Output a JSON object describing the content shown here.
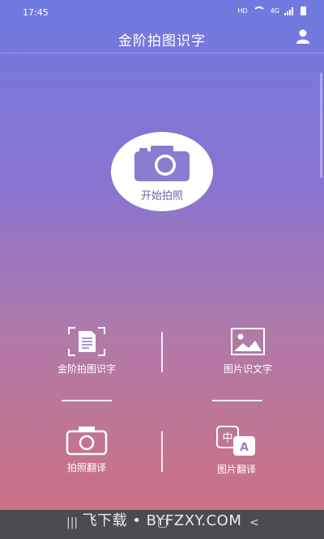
{
  "status": {
    "time": "17:45",
    "network": "HD",
    "signal": "4G"
  },
  "header": {
    "title": "金阶拍图识字",
    "user_icon": "user-icon"
  },
  "capture": {
    "label": "开始拍照",
    "icon": "camera-icon",
    "label_color": "#6a63a8"
  },
  "grid": {
    "items": [
      {
        "label": "金阶拍图识字",
        "icon": "document-scan-icon"
      },
      {
        "label": "图片识文字",
        "icon": "image-icon"
      },
      {
        "label": "拍照翻译",
        "icon": "camera-icon"
      },
      {
        "label": "图片翻译",
        "icon": "translate-icon"
      }
    ]
  },
  "watermark": {
    "text": "飞下载 • BYFZXY.COM"
  },
  "colors": {
    "gradient_top": "#6f7ae0",
    "gradient_bottom": "#d0707e",
    "accent": "#8a74cf",
    "nav_bar": "#4d4b52"
  }
}
